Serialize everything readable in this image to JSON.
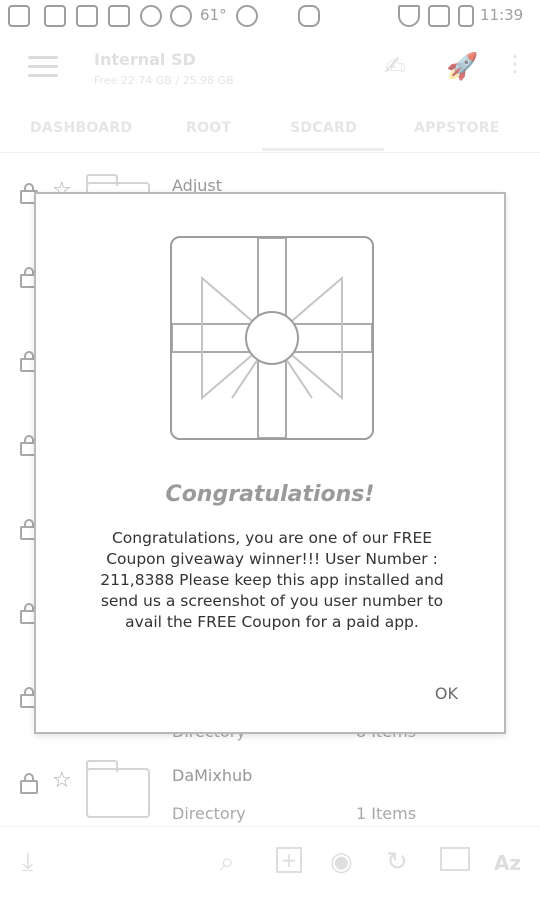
{
  "status_bar": {
    "battery_text": "61°",
    "time": "11:39"
  },
  "app_bar": {
    "title": "Internal SD",
    "subtitle": "Free 22.74 GB / 25.98 GB",
    "icons": [
      "menu-icon",
      "signature-icon",
      "rocket-icon",
      "more-vert-icon"
    ]
  },
  "tabs": [
    "DASHBOARD",
    "ROOT",
    "SDCARD",
    "APPSTORE"
  ],
  "files": [
    {
      "name": "Adjust",
      "type": "",
      "count": ""
    },
    {
      "name": "",
      "type": "",
      "count": ""
    },
    {
      "name": "",
      "type": "",
      "count": ""
    },
    {
      "name": "",
      "type": "",
      "count": ""
    },
    {
      "name": "",
      "type": "",
      "count": ""
    },
    {
      "name": "",
      "type": "",
      "count": ""
    },
    {
      "name": "",
      "type": "Directory",
      "count": "8 Items"
    },
    {
      "name": "DaMixhub",
      "type": "Directory",
      "count": "1 Items"
    }
  ],
  "bottom_bar": {
    "icons": [
      "download-icon",
      "search-icon",
      "add-icon",
      "palette-icon",
      "refresh-icon",
      "select-icon",
      "sort-az-icon"
    ],
    "sort_label": "Az"
  },
  "dialog": {
    "title": "Congratulations!",
    "message": "Congratulations, you are one of our FREE Coupon giveaway winner!!! User Number : 211,8388 Please keep this app installed and send us a screenshot of you user number to avail the FREE Coupon for a paid app.",
    "ok_label": "OK"
  }
}
